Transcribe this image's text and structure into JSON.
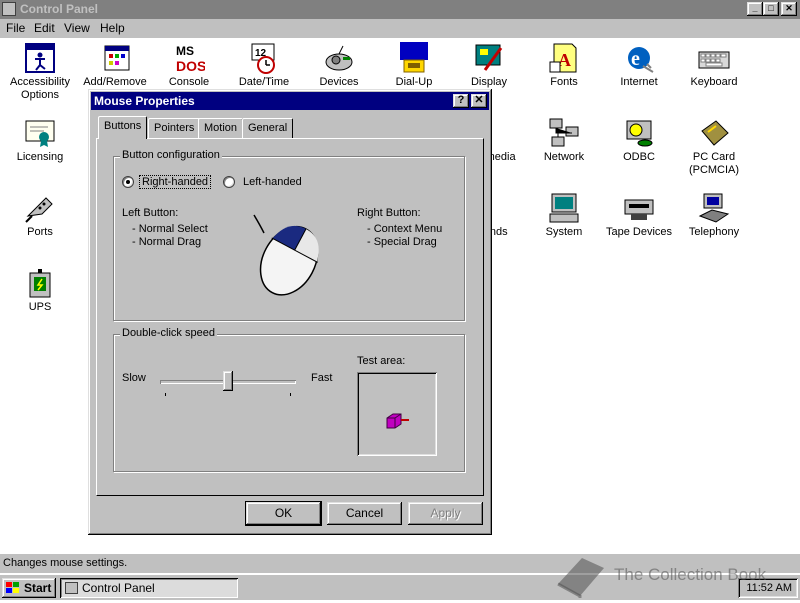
{
  "window": {
    "title": "Control Panel",
    "menu": [
      "File",
      "Edit",
      "View",
      "Help"
    ]
  },
  "icons": [
    {
      "label": "Accessibility Options",
      "icon": "accessibility-icon"
    },
    {
      "label": "Add/Remove",
      "icon": "add-remove-icon"
    },
    {
      "label": "Console",
      "icon": "console-icon"
    },
    {
      "label": "Date/Time",
      "icon": "date-time-icon"
    },
    {
      "label": "Devices",
      "icon": "devices-icon"
    },
    {
      "label": "Dial-Up",
      "icon": "dial-up-icon"
    },
    {
      "label": "Display",
      "icon": "display-icon"
    },
    {
      "label": "Fonts",
      "icon": "fonts-icon"
    },
    {
      "label": "Internet",
      "icon": "internet-icon"
    },
    {
      "label": "Keyboard",
      "icon": "keyboard-icon"
    },
    {
      "label": "Licensing",
      "icon": "licensing-icon"
    },
    {
      "label": "Multimedia",
      "icon": "multimedia-icon"
    },
    {
      "label": "Network",
      "icon": "network-icon"
    },
    {
      "label": "ODBC",
      "icon": "odbc-icon"
    },
    {
      "label": "PC Card (PCMCIA)",
      "icon": "pc-card-icon"
    },
    {
      "label": "Ports",
      "icon": "ports-icon"
    },
    {
      "label": "Sounds",
      "icon": "sounds-icon"
    },
    {
      "label": "System",
      "icon": "system-icon"
    },
    {
      "label": "Tape Devices",
      "icon": "tape-devices-icon"
    },
    {
      "label": "Telephony",
      "icon": "telephony-icon"
    },
    {
      "label": "UPS",
      "icon": "ups-icon"
    }
  ],
  "status_bar": "Changes mouse settings.",
  "taskbar": {
    "start_label": "Start",
    "task_label": "Control Panel",
    "clock": "11:52 AM"
  },
  "watermark": "The Collection Book",
  "dialog": {
    "title": "Mouse Properties",
    "help_btn": "?",
    "close_btn": "✕",
    "tabs": [
      "Buttons",
      "Pointers",
      "Motion",
      "General"
    ],
    "active_tab": "Buttons",
    "button_config": {
      "legend": "Button configuration",
      "right_handed": "Right-handed",
      "left_handed": "Left-handed",
      "selected": "right",
      "left_button_title": "Left Button:",
      "left_button_items": [
        "-  Normal Select",
        "-  Normal Drag"
      ],
      "right_button_title": "Right Button:",
      "right_button_items": [
        "-  Context Menu",
        "-  Special Drag"
      ]
    },
    "double_click": {
      "legend": "Double-click speed",
      "slow": "Slow",
      "fast": "Fast",
      "test_area": "Test area:",
      "speed_fraction": 0.5
    },
    "buttons": {
      "ok": "OK",
      "cancel": "Cancel",
      "apply": "Apply"
    }
  },
  "colors": {
    "titlebar_active": "#000080",
    "titlebar_inactive": "#808080",
    "face": "#c0c0c0"
  }
}
